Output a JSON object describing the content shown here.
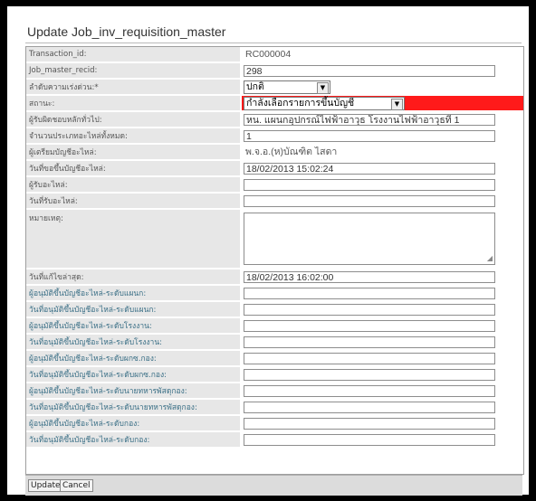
{
  "title": "Update Job_inv_requisition_master",
  "fields": [
    {
      "label": "Transaction_id:",
      "value": "RC000004",
      "kind": "plain"
    },
    {
      "label": "Job_master_recid:",
      "value": "298",
      "kind": "text"
    },
    {
      "label": "ลำดับความเร่งด่วน:*",
      "value": "ปกติ",
      "kind": "select"
    },
    {
      "label": "สถานะ:",
      "value": "กำลังเลือกรายการขึ้นบัญชี",
      "kind": "select-red"
    },
    {
      "label": "ผู้รับผิดชอบหลักทั่วไป:",
      "value": "หน. แผนกอุปกรณ์ไฟฟ้าอาวุธ โรงงานไฟฟ้าอาวุธที่ 1",
      "kind": "text"
    },
    {
      "label": "จำนวนประเภทอะไหล่ทั้งหมด:",
      "value": "1",
      "kind": "text"
    },
    {
      "label": "ผู้เตรียมบัญชีอะไหล่:",
      "value": "พ.จ.อ.(ห)บัณฑิต ไสดา",
      "kind": "plain"
    },
    {
      "label": "วันที่ขอขึ้นบัญชีอะไหล่:",
      "value": "18/02/2013 15:02:24",
      "kind": "text"
    },
    {
      "label": "ผู้รับอะไหล่:",
      "value": "",
      "kind": "text"
    },
    {
      "label": "วันที่รับอะไหล่:",
      "value": "",
      "kind": "text"
    },
    {
      "label": "หมายเหตุ:",
      "value": "",
      "kind": "area"
    },
    {
      "label": "วันที่แก้ไขล่าสุด:",
      "value": "18/02/2013 16:02:00",
      "kind": "text"
    },
    {
      "label": "ผู้อนุมัติขึ้นบัญชีอะไหล่-ระดับแผนก:",
      "value": "",
      "kind": "text",
      "blue": true
    },
    {
      "label": "วันที่อนุมัติขึ้นบัญชีอะไหล่-ระดับแผนก:",
      "value": "",
      "kind": "text",
      "blue": true
    },
    {
      "label": "ผู้อนุมัติขึ้นบัญชีอะไหล่-ระดับโรงงาน:",
      "value": "",
      "kind": "text",
      "blue": true
    },
    {
      "label": "วันที่อนุมัติขึ้นบัญชีอะไหล่-ระดับโรงงาน:",
      "value": "",
      "kind": "text",
      "blue": true
    },
    {
      "label": "ผู้อนุมัติขึ้นบัญชีอะไหล่-ระดับผกซ.กอง:",
      "value": "",
      "kind": "text",
      "blue": true
    },
    {
      "label": "วันที่อนุมัติขึ้นบัญชีอะไหล่-ระดับผกซ.กอง:",
      "value": "",
      "kind": "text",
      "blue": true
    },
    {
      "label": "ผู้อนุมัติขึ้นบัญชีอะไหล่-ระดับนายทหารพัสดุกอง:",
      "value": "",
      "kind": "text",
      "blue": true
    },
    {
      "label": "วันที่อนุมัติขึ้นบัญชีอะไหล่-ระดับนายทหารพัสดุกอง:",
      "value": "",
      "kind": "text",
      "blue": true
    },
    {
      "label": "ผู้อนุมัติขึ้นบัญชีอะไหล่-ระดับกอง:",
      "value": "",
      "kind": "text",
      "blue": true
    },
    {
      "label": "วันที่อนุมัติขึ้นบัญชีอะไหล่-ระดับกอง:",
      "value": "",
      "kind": "text",
      "blue": true
    }
  ],
  "buttons": {
    "update": "Update",
    "cancel": "Cancel"
  },
  "colors": {
    "status_highlight": "#ff1a1a",
    "label_bg": "#e7e7e7",
    "blue_label": "#3a6f86"
  }
}
